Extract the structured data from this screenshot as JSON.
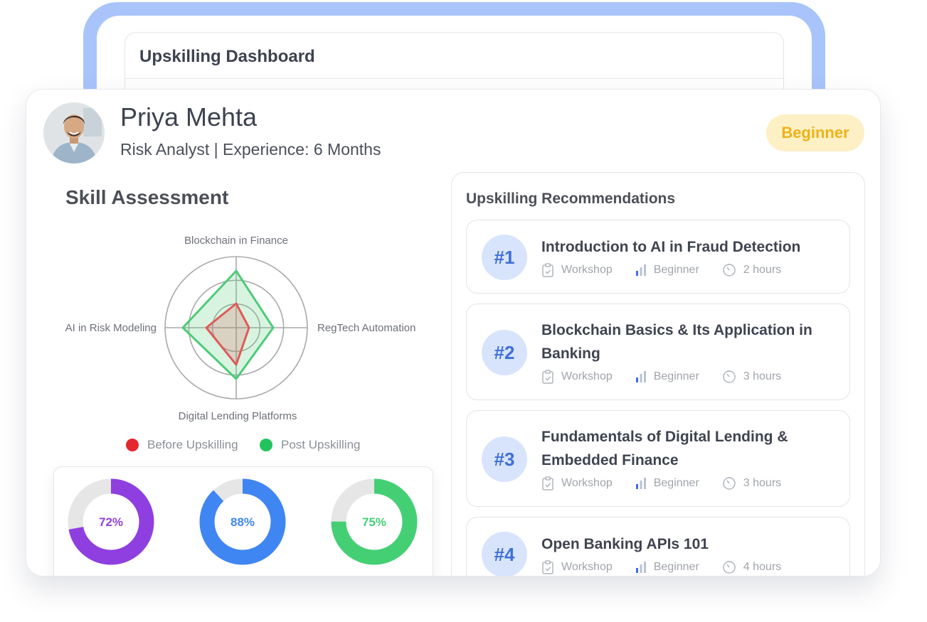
{
  "dashboard": {
    "title": "Upskilling Dashboard"
  },
  "profile": {
    "name": "Priya Mehta",
    "role_line": "Risk Analyst | Experience: 6 Months",
    "level_badge": "Beginner"
  },
  "skill_assessment": {
    "title": "Skill Assessment",
    "legend": {
      "before": "Before Upskilling",
      "post": "Post Upskilling"
    }
  },
  "chart_data": {
    "type": "radar",
    "axes": [
      "Blockchain in Finance",
      "RegTech Automation",
      "Digital Lending Platforms",
      "AI in Risk Modeling"
    ],
    "rmax": 100,
    "rings": 3,
    "series": [
      {
        "name": "Before Upskilling",
        "values": [
          34,
          18,
          52,
          42
        ],
        "color": "#e05a5a"
      },
      {
        "name": "Post Upskilling",
        "values": [
          80,
          52,
          72,
          75
        ],
        "color": "#4ecb78"
      }
    ]
  },
  "progress": [
    {
      "label": "72%",
      "value": 0.72,
      "color": "#8f3fe0"
    },
    {
      "label": "88%",
      "value": 0.88,
      "color": "#3f86f2"
    },
    {
      "label": "75%",
      "value": 0.75,
      "color": "#45cf75"
    }
  ],
  "recommendations": {
    "title": "Upskilling Recommendations",
    "items": [
      {
        "rank": "#1",
        "title": "Introduction to AI in Fraud Detection",
        "type": "Workshop",
        "level": "Beginner",
        "duration": "2 hours"
      },
      {
        "rank": "#2",
        "title": "Blockchain Basics & Its Application in Banking",
        "type": "Workshop",
        "level": "Beginner",
        "duration": "3 hours"
      },
      {
        "rank": "#3",
        "title": "Fundamentals of Digital Lending & Embedded Finance",
        "type": "Workshop",
        "level": "Beginner",
        "duration": "3 hours"
      },
      {
        "rank": "#4",
        "title": "Open Banking APIs 101",
        "type": "Workshop",
        "level": "Beginner",
        "duration": "4 hours"
      }
    ]
  },
  "icons": {
    "type": "clipboard-icon",
    "level": "bar-chart-icon",
    "duration": "timer-icon"
  }
}
